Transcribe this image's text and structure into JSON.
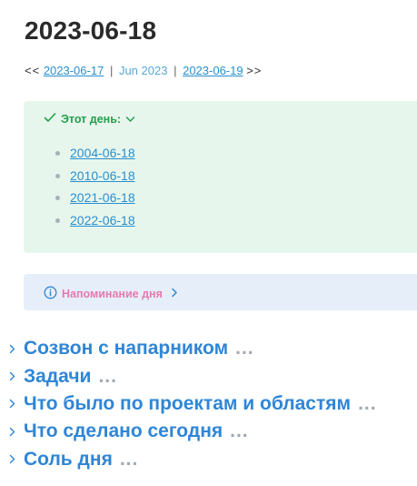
{
  "page": {
    "title": "2023-06-18"
  },
  "nav": {
    "prev_arrows": "<<",
    "prev_link": "2023-06-17",
    "month_link": "Jun 2023",
    "next_link": "2023-06-19",
    "next_arrows": ">>",
    "separator": "|"
  },
  "this_day": {
    "title": "Этот день:",
    "icon": "check-icon",
    "toggle_icon": "chevron-down-icon",
    "accent_color": "#23a04f",
    "background": "#e7f6ec",
    "items": [
      {
        "label": "2004-06-18"
      },
      {
        "label": "2010-06-18"
      },
      {
        "label": "2021-06-18"
      },
      {
        "label": "2022-06-18"
      }
    ]
  },
  "reminder": {
    "title": "Напоминание дня",
    "icon": "info-icon",
    "toggle_icon": "chevron-right-icon",
    "accent_color": "#e67ab0",
    "background": "#e6eef9"
  },
  "sections": [
    {
      "title": "Созвон с напарником",
      "ellipsis": "..."
    },
    {
      "title": "Задачи",
      "ellipsis": "..."
    },
    {
      "title": "Что было по проектам и областям",
      "ellipsis": "..."
    },
    {
      "title": "Что сделано сегодня",
      "ellipsis": "..."
    },
    {
      "title": "Соль дня",
      "ellipsis": "..."
    }
  ],
  "colors": {
    "heading": "#2f86d6",
    "link": "#2a8fcf",
    "muted": "#a0a8b0"
  }
}
